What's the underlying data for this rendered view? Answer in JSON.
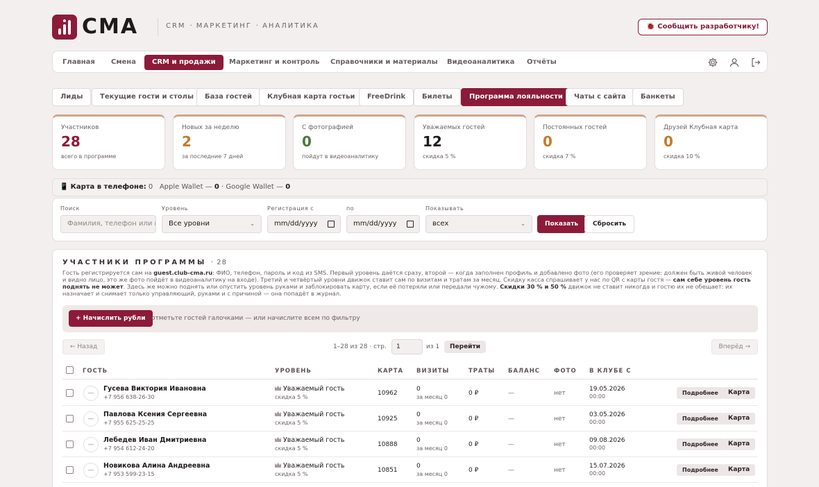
{
  "brand": {
    "name": "CMA",
    "accent": "#8c1b3a"
  },
  "header": {
    "nav": [
      "CRM",
      "МАРКЕТИНГ",
      "АНАЛИТИКА"
    ],
    "separator": "·",
    "report_button": "🐞 Сообщить разработчику!"
  },
  "mainnav": {
    "items": [
      "Главная",
      "Смена",
      "CRM и продажи",
      "Маркетинг и контроль",
      "Справочники и материалы",
      "Видеоаналитика",
      "Отчёты"
    ],
    "active_index": 2,
    "icons": [
      "gear-icon",
      "user-icon",
      "logout-icon"
    ]
  },
  "subtabs": {
    "items": [
      "Лиды",
      "Текущие гости и столы",
      "База гостей",
      "Клубная карта гостьи",
      "FreeDrink",
      "Билеты",
      "Программа лояльности",
      "Чаты с сайта",
      "Банкеты"
    ],
    "active_index": 6
  },
  "stats": [
    {
      "label": "Участников",
      "value": "28",
      "sub": "всего в программе",
      "color": "#8c1b3a"
    },
    {
      "label": "Новых за неделю",
      "value": "2",
      "sub": "за последние 7 дней",
      "color": "#c47a2c"
    },
    {
      "label": "С фотографией",
      "value": "0",
      "sub": "пойдут в видеоаналитику",
      "color": "#4a7a3c"
    },
    {
      "label": "Уважаемых гостей",
      "value": "12",
      "sub": "скидка 5 %",
      "color": "#1f1a1c"
    },
    {
      "label": "Постоянных гостей",
      "value": "0",
      "sub": "скидка 7 %",
      "color": "#c47a2c"
    },
    {
      "label": "Друзей Клубная карта",
      "value": "0",
      "sub": "скидка 10 %",
      "color": "#c47a2c"
    }
  ],
  "wallet": {
    "icon": "📱",
    "label": "Карта в телефоне:",
    "total": "0",
    "apple_label": "Apple Wallet —",
    "apple": "0",
    "sep": "·",
    "google_label": "Google Wallet —",
    "google": "0"
  },
  "filters": {
    "search_label": "Поиск",
    "search_placeholder": "Фамилия, телефон или номер карты",
    "level_label": "Уровень",
    "level_value": "Все уровни",
    "reg_label": "Регистрация с",
    "reg_value": "mm/dd/yyyy",
    "to_label": "по",
    "to_value": "mm/dd/yyyy",
    "show_label": "Показывать",
    "show_value": "всех",
    "show_button": "Показать",
    "reset_button": "Сбросить"
  },
  "members": {
    "title": "УЧАСТНИКИ ПРОГРАММЫ",
    "count": "· 28",
    "desc": {
      "p1": "Гость регистрируется сам на ",
      "site": "guest.club-cma.ru",
      "p2": ": ФИО, телефон, пароль и код из SMS. Первый уровень даётся сразу, второй — когда заполнен профиль и добавлено фото (его проверяет зрение: должен быть живой человек и видно лицо, это же фото пойдёт в видеоаналитику на входе). Третий и четвёртый уровни движок ставит сам по визитам и тратам за месяц. Скидку касса спрашивает у нас по QR с карты гостя — ",
      "b1": "сам себе уровень гость поднять не может",
      "p3": ". Здесь же можно поднять или опустить уровень руками и заблокировать карту, если её потеряли или передали чужому. ",
      "b2": "Скидки 30 % и 50 %",
      "p4": " движок не ставит никогда и гостю их не обещает: их назначает и снимает только управляющий, руками и с причиной — она попадёт в журнал."
    },
    "bulk_button": "+ Начислить рубли",
    "bulk_hint": "отметьте гостей галочками — или начислите всем по фильтру",
    "pager": {
      "prev": "← Назад",
      "range": "1–28 из 28 · стр.",
      "page": "1",
      "of": "из 1",
      "go": "Перейти",
      "next": "Вперёд →"
    },
    "columns": [
      "ГОСТЬ",
      "УРОВЕНЬ",
      "КАРТА",
      "ВИЗИТЫ",
      "ТРАТЫ",
      "БАЛАНС",
      "ФОТО",
      "В КЛУБЕ С"
    ],
    "rows": [
      {
        "avatar": "—",
        "name": "Гусева Виктория Ивановна",
        "phone": "+7 956 638-26-30",
        "level": "Уважаемый гость",
        "level_sub": "скидка 5 %",
        "card": "10962",
        "visits": "0",
        "visits_sub": "за месяц 0",
        "spend": "0 ₽",
        "balance": "—",
        "photo": "нет",
        "date": "19.05.2026",
        "time": "00:00",
        "more": "Подробнее",
        "card_btn": "Карта"
      },
      {
        "avatar": "—",
        "name": "Павлова Ксения Сергеевна",
        "phone": "+7 955 625-25-25",
        "level": "Уважаемый гость",
        "level_sub": "скидка 5 %",
        "card": "10925",
        "visits": "0",
        "visits_sub": "за месяц 0",
        "spend": "0 ₽",
        "balance": "—",
        "photo": "нет",
        "date": "03.05.2026",
        "time": "00:00",
        "more": "Подробнее",
        "card_btn": "Карта"
      },
      {
        "avatar": "—",
        "name": "Лебедев Иван Дмитриевна",
        "phone": "+7 954 612-24-20",
        "level": "Уважаемый гость",
        "level_sub": "скидка 5 %",
        "card": "10888",
        "visits": "0",
        "visits_sub": "за месяц 0",
        "spend": "0 ₽",
        "balance": "—",
        "photo": "нет",
        "date": "09.08.2026",
        "time": "00:00",
        "more": "Подробнее",
        "card_btn": "Карта"
      },
      {
        "avatar": "—",
        "name": "Новикова Алина Андреевна",
        "phone": "+7 953 599-23-15",
        "level": "Уважаемый гость",
        "level_sub": "скидка 5 %",
        "card": "10851",
        "visits": "0",
        "visits_sub": "за месяц 0",
        "spend": "0 ₽",
        "balance": "—",
        "photo": "нет",
        "date": "15.07.2026",
        "time": "00:00",
        "more": "Подробнее",
        "card_btn": "Карта"
      }
    ]
  }
}
